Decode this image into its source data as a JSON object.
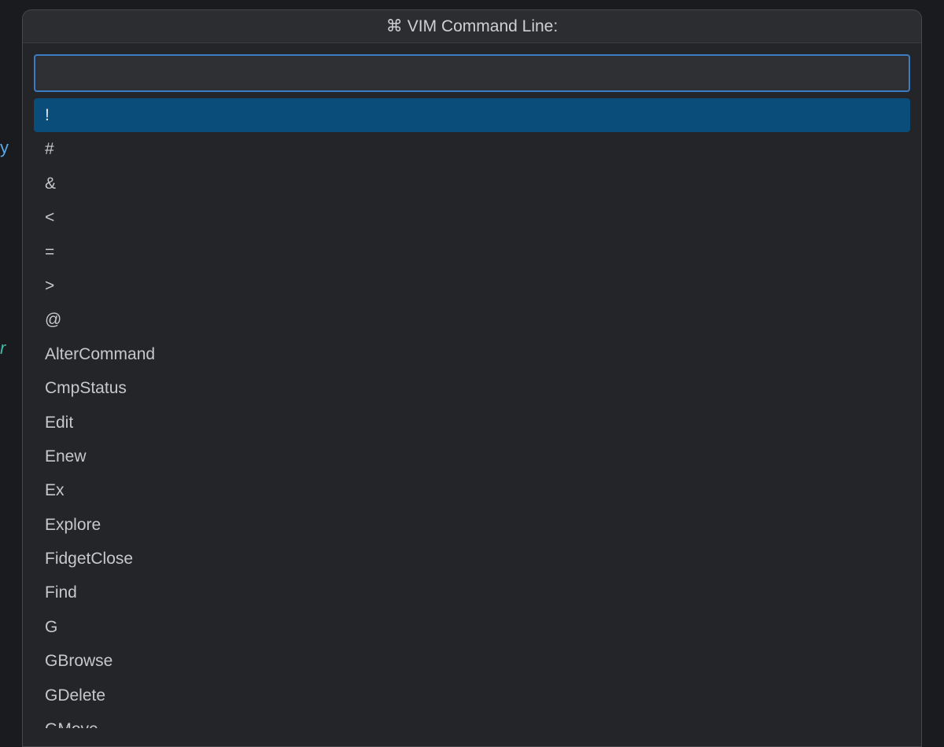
{
  "background": {
    "text1": "y",
    "text2": "r"
  },
  "palette": {
    "icon": "⌘",
    "title": "VIM Command Line:",
    "search_value": "",
    "search_placeholder": "",
    "selected_index": 0,
    "items": [
      "!",
      "#",
      "&",
      "<",
      "=",
      ">",
      "@",
      "AlterCommand",
      "CmpStatus",
      "Edit",
      "Enew",
      "Ex",
      "Explore",
      "FidgetClose",
      "Find",
      "G",
      "GBrowse",
      "GDelete",
      "GMove"
    ]
  },
  "colors": {
    "background": "#1a1b1e",
    "panel": "#242528",
    "header": "#2c2d30",
    "border": "#47484c",
    "input_bg": "#2f3033",
    "input_border": "#3c7cc4",
    "selected_bg": "#0b4d7a",
    "text": "#c8c8cc",
    "title_text": "#d0d0d4"
  }
}
